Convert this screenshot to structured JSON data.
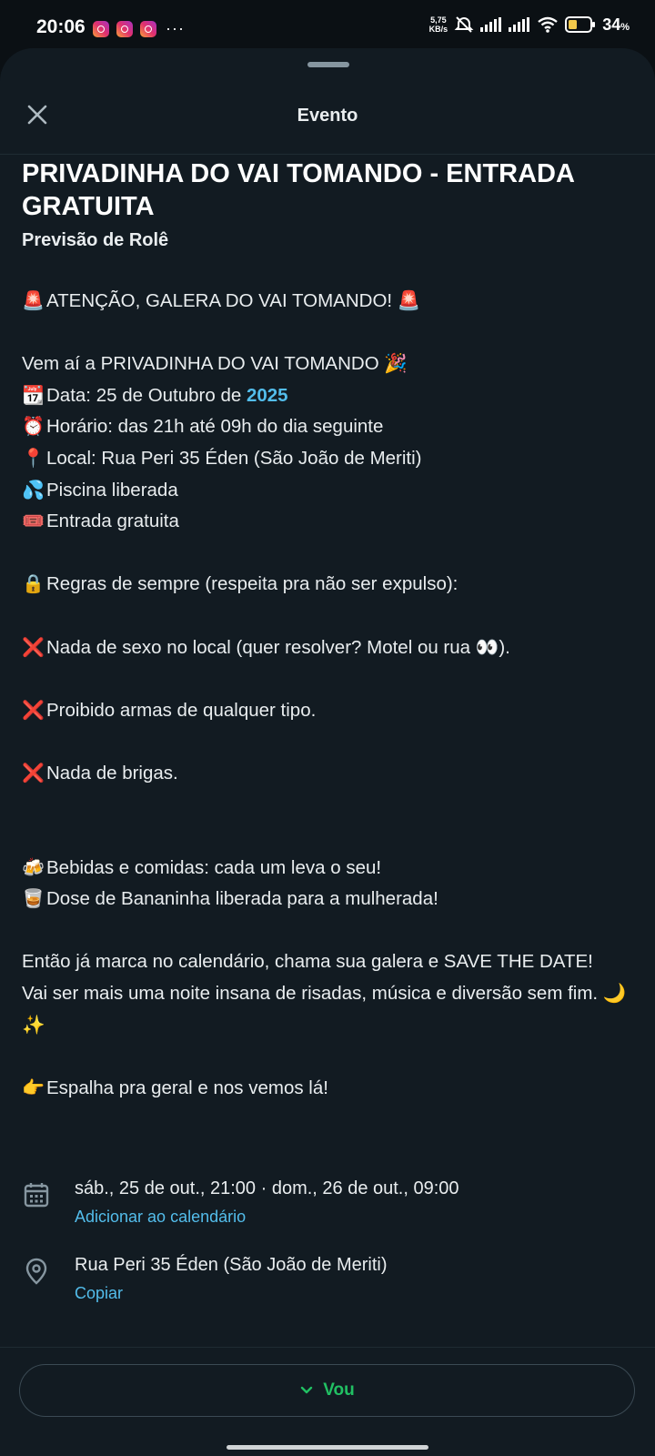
{
  "status_bar": {
    "time": "20:06",
    "notifications": [
      "instagram-icon",
      "instagram-icon",
      "instagram-icon"
    ],
    "more": "···",
    "net_speed_value": "5,75",
    "net_speed_unit": "KB/s",
    "battery_percent": "34",
    "battery_unit": "%"
  },
  "header": {
    "title": "Evento",
    "close_icon": "close-icon"
  },
  "event": {
    "title": "PRIVADINHA DO VAI TOMANDO - ENTRADA GRATUITA",
    "subtitle": "Previsão de Rolê",
    "desc": {
      "attention_emoji": "🚨",
      "attention": "ATENÇÃO, GALERA DO VAI TOMANDO!",
      "intro": "Vem aí a PRIVADINHA DO VAI TOMANDO",
      "intro_emoji": "🎉",
      "date_emoji": "📆",
      "date_prefix": "Data: 25 de Outubro de",
      "date_year": "2025",
      "time_emoji": "⏰",
      "time": "Horário: das 21h até 09h do dia seguinte",
      "place_emoji": "📍",
      "place": "Local: Rua Peri 35 Éden (São João de Meriti)",
      "pool_emoji": "💦",
      "pool": "Piscina liberada",
      "ticket_emoji": "🎟️",
      "ticket": "Entrada gratuita",
      "rules_emoji": "🔒",
      "rules": "Regras de sempre (respeita pra não ser expulso):",
      "x_emoji": "❌",
      "rule1": "Nada de sexo no local (quer resolver? Motel ou rua",
      "rule1_emoji": "👀",
      "rule1_end": ").",
      "rule2": "Proibido armas de qualquer tipo.",
      "rule3": "Nada de brigas.",
      "drinks_emoji": "🍻",
      "drinks": "Bebidas e comidas: cada um leva o seu!",
      "dose_emoji": "🥃",
      "dose": "Dose de Bananinha liberada para a mulherada!",
      "save": "Então já marca no calendário, chama sua galera e SAVE THE DATE!",
      "fun": "Vai ser mais uma noite insana de risadas, música e diversão sem fim.",
      "fun_emoji": "🌙✨",
      "share_emoji": "👉",
      "share": "Espalha pra geral e nos vemos lá!"
    },
    "when": {
      "icon": "calendar-icon",
      "text": "sáb., 25 de out., 21:00 · dom., 26 de out., 09:00",
      "action": "Adicionar ao calendário"
    },
    "where": {
      "icon": "location-pin-icon",
      "text": "Rua Peri 35 Éden (São João de Meriti)",
      "action": "Copiar"
    }
  },
  "footer": {
    "rsvp_label": "Vou",
    "rsvp_icon": "chevron-down-icon"
  },
  "colors": {
    "sheet_bg": "#121b22",
    "link": "#53bdeb",
    "accent_green": "#21c063"
  }
}
